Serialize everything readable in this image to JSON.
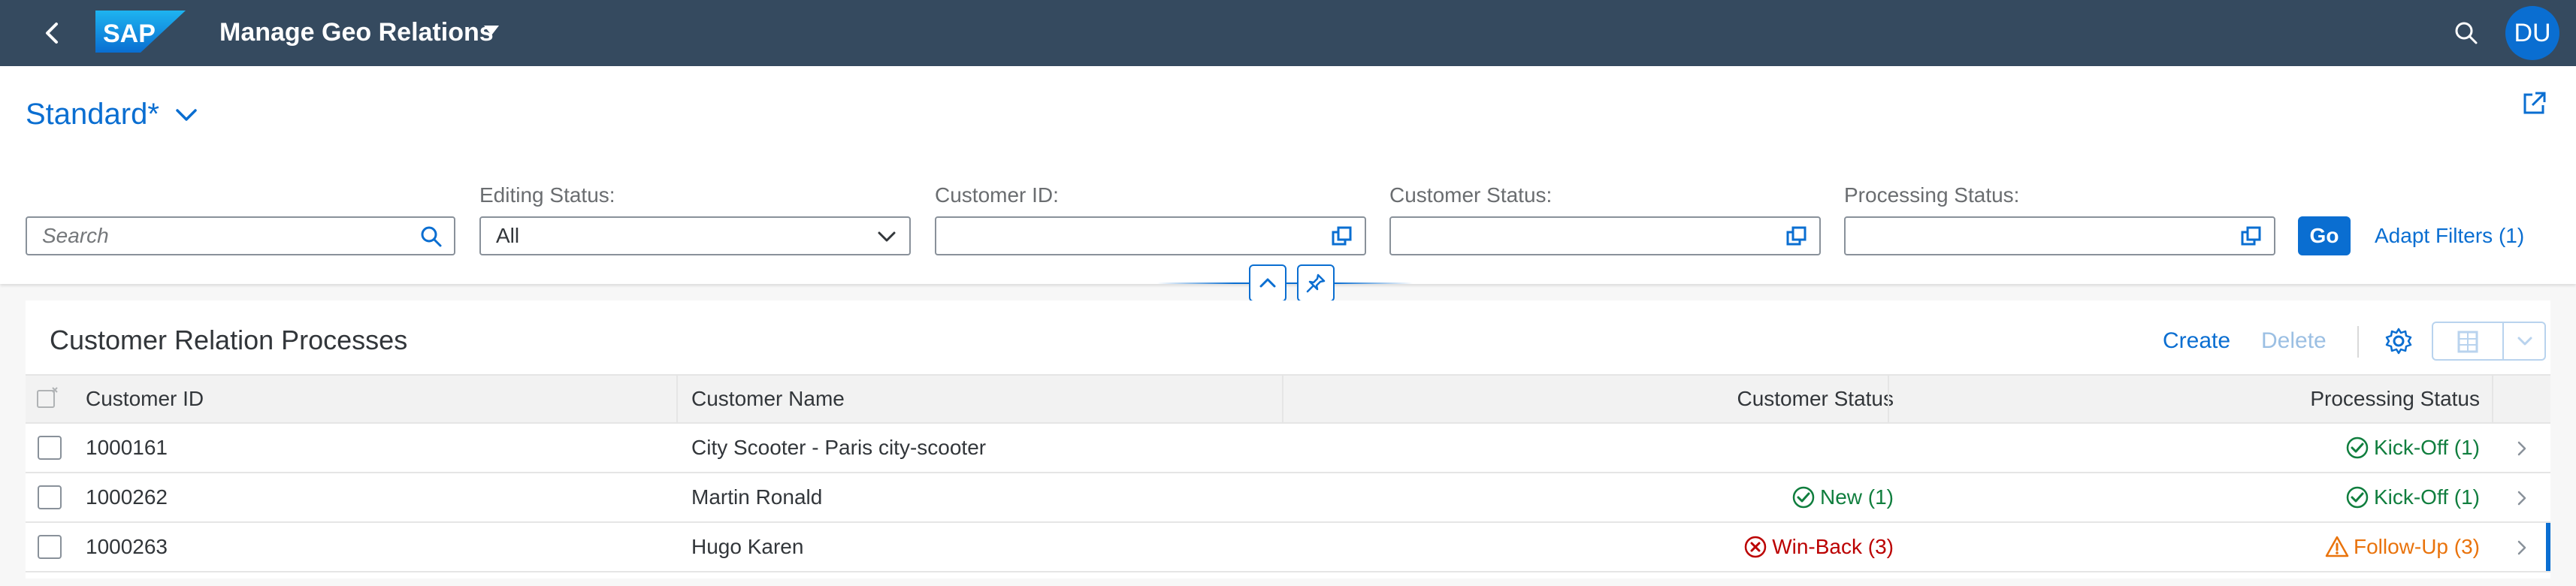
{
  "shell": {
    "app_title": "Manage Geo Relations",
    "logo_text": "SAP",
    "user_initials": "DU"
  },
  "header": {
    "variant_name": "Standard*",
    "filters": {
      "search_placeholder": "Search",
      "editing_status_label": "Editing Status:",
      "editing_status_value": "All",
      "customer_id_label": "Customer ID:",
      "customer_id_value": "",
      "customer_status_label": "Customer Status:",
      "customer_status_value": "",
      "processing_status_label": "Processing Status:",
      "processing_status_value": ""
    },
    "go_label": "Go",
    "adapt_filters_label": "Adapt Filters (1)"
  },
  "table": {
    "title": "Customer Relation Processes",
    "create_label": "Create",
    "delete_label": "Delete",
    "columns": [
      "Customer ID",
      "Customer Name",
      "Customer Status",
      "Processing Status"
    ],
    "rows": [
      {
        "customer_id": "1000161",
        "customer_name": "City Scooter - Paris city-scooter",
        "customer_status": "",
        "customer_status_icon": "",
        "processing_status": "Kick-Off (1)",
        "processing_status_icon": "success-icon"
      },
      {
        "customer_id": "1000262",
        "customer_name": "Martin Ronald",
        "customer_status": "New (1)",
        "customer_status_icon": "success-icon",
        "processing_status": "Kick-Off (1)",
        "processing_status_icon": "success-icon"
      },
      {
        "customer_id": "1000263",
        "customer_name": "Hugo Karen",
        "customer_status": "Win-Back (3)",
        "customer_status_icon": "error-icon",
        "processing_status": "Follow-Up (3)",
        "processing_status_icon": "warning-icon"
      }
    ]
  },
  "colors": {
    "shell": "#354a5f",
    "accent": "#0a6ed1",
    "success": "#107e3e",
    "error": "#bb0000",
    "warning": "#e9730c"
  }
}
